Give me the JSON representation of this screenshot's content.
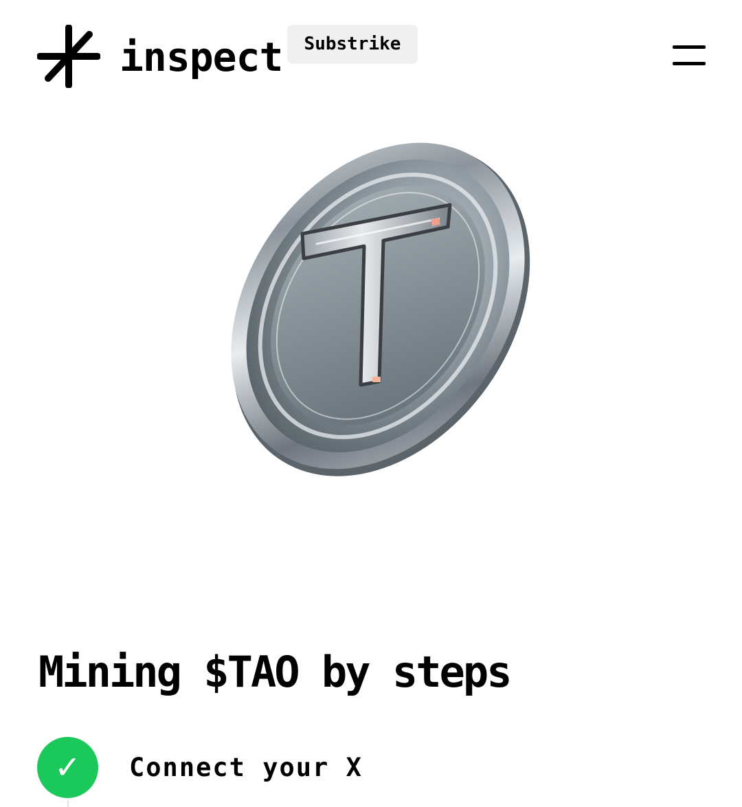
{
  "header": {
    "brand": "inspect",
    "badge": "Substrike",
    "logo_icon": "asterisk-logo-icon",
    "menu_icon": "hamburger-menu-icon"
  },
  "hero": {
    "image": "tao-coin-image",
    "coin_letter": "T"
  },
  "main": {
    "title": "Mining $TAO by steps",
    "steps": [
      {
        "label": "Connect your X",
        "status": "completed",
        "icon": "checkmark-icon",
        "check": "✓"
      }
    ]
  },
  "colors": {
    "background": "#ffffff",
    "text": "#000000",
    "badge_bg": "#f0f0f0",
    "success": "#1bc95a"
  }
}
